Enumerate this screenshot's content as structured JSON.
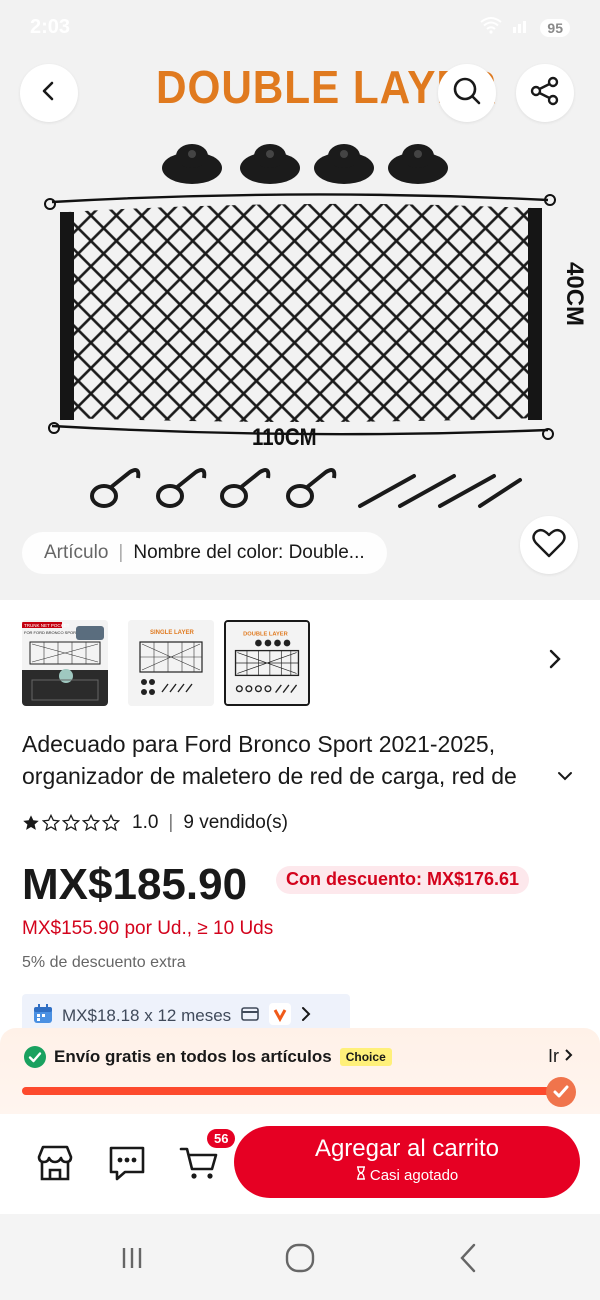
{
  "status": {
    "time": "2:03",
    "battery": "95"
  },
  "hero": {
    "title": "DOUBLE LAYER",
    "dimension_height": "40CM",
    "dimension_width": "110CM"
  },
  "variant_chip": {
    "key": "Artículo",
    "value": "Nombre del color: Double..."
  },
  "thumbnails": {
    "items": [
      {
        "name": "thumb-1",
        "caption": "TRUNK NET POCKET",
        "sub": "FOR FORD BRONCO SPORT 2021-2025"
      },
      {
        "name": "thumb-2",
        "caption": "SINGLE LAYER"
      },
      {
        "name": "thumb-3",
        "caption": "DOUBLE LAYER"
      }
    ]
  },
  "product": {
    "title": "Adecuado para Ford Bronco Sport 2021-2025, organizador de maletero de red de carga, red de",
    "rating": "1.0",
    "stars_filled": 1,
    "stars_total": 5,
    "sold": "9 vendido(s)"
  },
  "pricing": {
    "price": "MX$185.90",
    "discount_badge": "Con descuento: MX$176.61",
    "bulk_price": "MX$155.90 por Ud., ≥ 10 Uds",
    "extra_discount": "5% de descuento extra",
    "installments": "MX$18.18 x 12 meses"
  },
  "shipping": {
    "text": "Envío gratis en todos los artículos",
    "badge": "Choice",
    "link": "Ir",
    "progress": 1.0
  },
  "actions": {
    "cart_count": "56",
    "add_to_cart": "Agregar al carrito",
    "stock_note": "Casi agotado"
  },
  "colors": {
    "accent": "#e60023",
    "title_orange": "#e07a1f",
    "progress": "#fd4a2d"
  }
}
